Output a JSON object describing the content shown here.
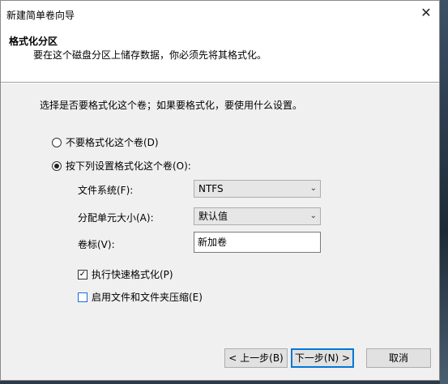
{
  "window": {
    "title": "新建简单卷向导",
    "close_glyph": "✕"
  },
  "header": {
    "title": "格式化分区",
    "subtitle": "要在这个磁盘分区上储存数据，你必须先将其格式化。"
  },
  "main": {
    "prompt": "选择是否要格式化这个卷；如果要格式化，要使用什么设置。",
    "option_no_format": {
      "label": "不要格式化这个卷(D)",
      "checked": false
    },
    "option_format": {
      "label": "按下列设置格式化这个卷(O):",
      "checked": true
    },
    "fields": {
      "filesystem": {
        "label": "文件系统(F):",
        "value": "NTFS"
      },
      "alloc_unit": {
        "label": "分配单元大小(A):",
        "value": "默认值"
      },
      "volume_label": {
        "label": "卷标(V):",
        "value": "新加卷"
      }
    },
    "quick_format": {
      "label": "执行快速格式化(P)",
      "checked": true
    },
    "compression": {
      "label": "启用文件和文件夹压缩(E)",
      "checked": false
    }
  },
  "footer": {
    "back_label": "< 上一步(B)",
    "next_label": "下一步(N) >",
    "cancel_label": "取消"
  },
  "icons": {
    "dropdown": "chevron-down-icon",
    "close": "close-icon"
  },
  "colors": {
    "focus_blue": "#0078d7",
    "dialog_bg": "#f0f0f0"
  }
}
